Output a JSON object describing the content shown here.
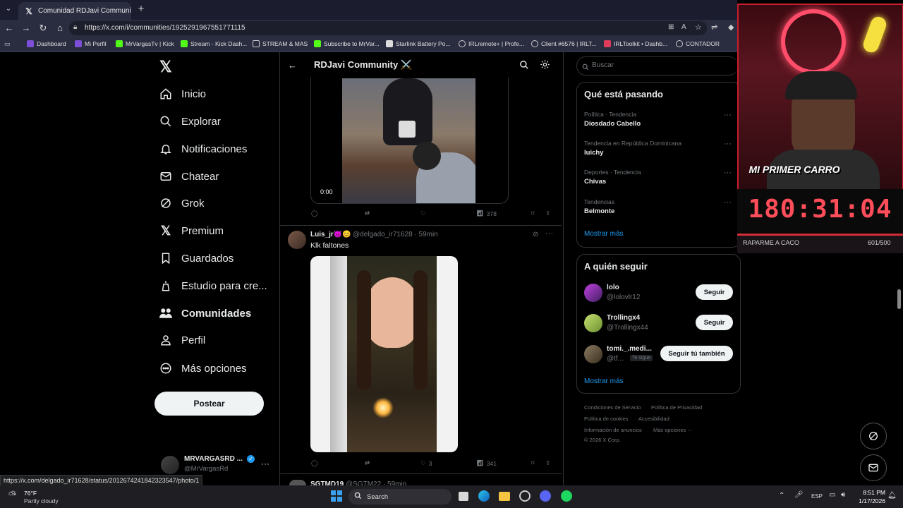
{
  "browser": {
    "tab_title": "Comunidad RDJavi Community ✕",
    "url": "https://x.com/i/communities/1925291967551771115",
    "bookmarks": [
      "Dashboard",
      "Mi Perfil",
      "MrVargasTv | Kick",
      "Stream - Kick Dash...",
      "STREAM & MAS",
      "Subscribe to MrVar...",
      "Starlink Battery Po...",
      "IRLremote+ | Profe...",
      "Client #6576 | IRLT...",
      "IRLToolkit • Dashb...",
      "CONTADOR"
    ],
    "status_url": "https://x.com/delgado_ir71628/status/2012674241842323547/photo/1"
  },
  "nav": {
    "items": [
      "Inicio",
      "Explorar",
      "Notificaciones",
      "Chatear",
      "Grok",
      "Premium",
      "Guardados",
      "Estudio para cre...",
      "Comunidades",
      "Perfil",
      "Más opciones"
    ],
    "post_label": "Postear",
    "account_name": "MRVARGASRD ...",
    "account_handle": "@MrVargasRd"
  },
  "header": {
    "title": "RDJavi Community ⚔️"
  },
  "post1": {
    "video_time": "0:00",
    "views": "378"
  },
  "post2": {
    "author": "Luis_jr😈😊",
    "handle": "@delgado_ir71628 · 59min",
    "text": "Klk faltones",
    "likes": "3",
    "views": "341"
  },
  "post3": {
    "author": "SGTMD19",
    "handle": "@SGTM22 · 59min"
  },
  "search": {
    "placeholder": "Buscar"
  },
  "trends": {
    "title": "Qué está pasando",
    "items": [
      {
        "cat": "Política · Tendencia",
        "name": "Diosdado Cabello"
      },
      {
        "cat": "Tendencia en República Dominicana",
        "name": "luichy"
      },
      {
        "cat": "Deportes · Tendencia",
        "name": "Chivas"
      },
      {
        "cat": "Tendencias",
        "name": "Belmonte"
      }
    ],
    "more": "Mostrar más"
  },
  "follow": {
    "title": "A quién seguir",
    "users": [
      {
        "name": "lolo",
        "handle": "@lolovlr12",
        "btn": "Seguir"
      },
      {
        "name": "Trollingx4",
        "handle": "@Trollingx44",
        "btn": "Seguir"
      },
      {
        "name": "tomi._.medi...",
        "handle": "@tf...",
        "badge": "Te sigue",
        "btn": "Seguir tú también"
      }
    ],
    "more": "Mostrar más"
  },
  "footer": {
    "links": [
      "Condiciones de Servicio",
      "Política de Privacidad",
      "Política de cookies",
      "Accesibilidad",
      "Información de anuncios",
      "Más opciones ···"
    ],
    "copyright": "© 2026 X Corp."
  },
  "overlay": {
    "cam_text": "MI PRIMER CARRO",
    "timer": "180:31:04",
    "sub_label": "RAPARME A CACO",
    "sub_count": "601/500"
  },
  "taskbar": {
    "temp": "76°F",
    "weather": "Partly cloudy",
    "search": "Search",
    "lang": "ESP",
    "time": "8:51 PM",
    "date": "1/17/2026"
  }
}
